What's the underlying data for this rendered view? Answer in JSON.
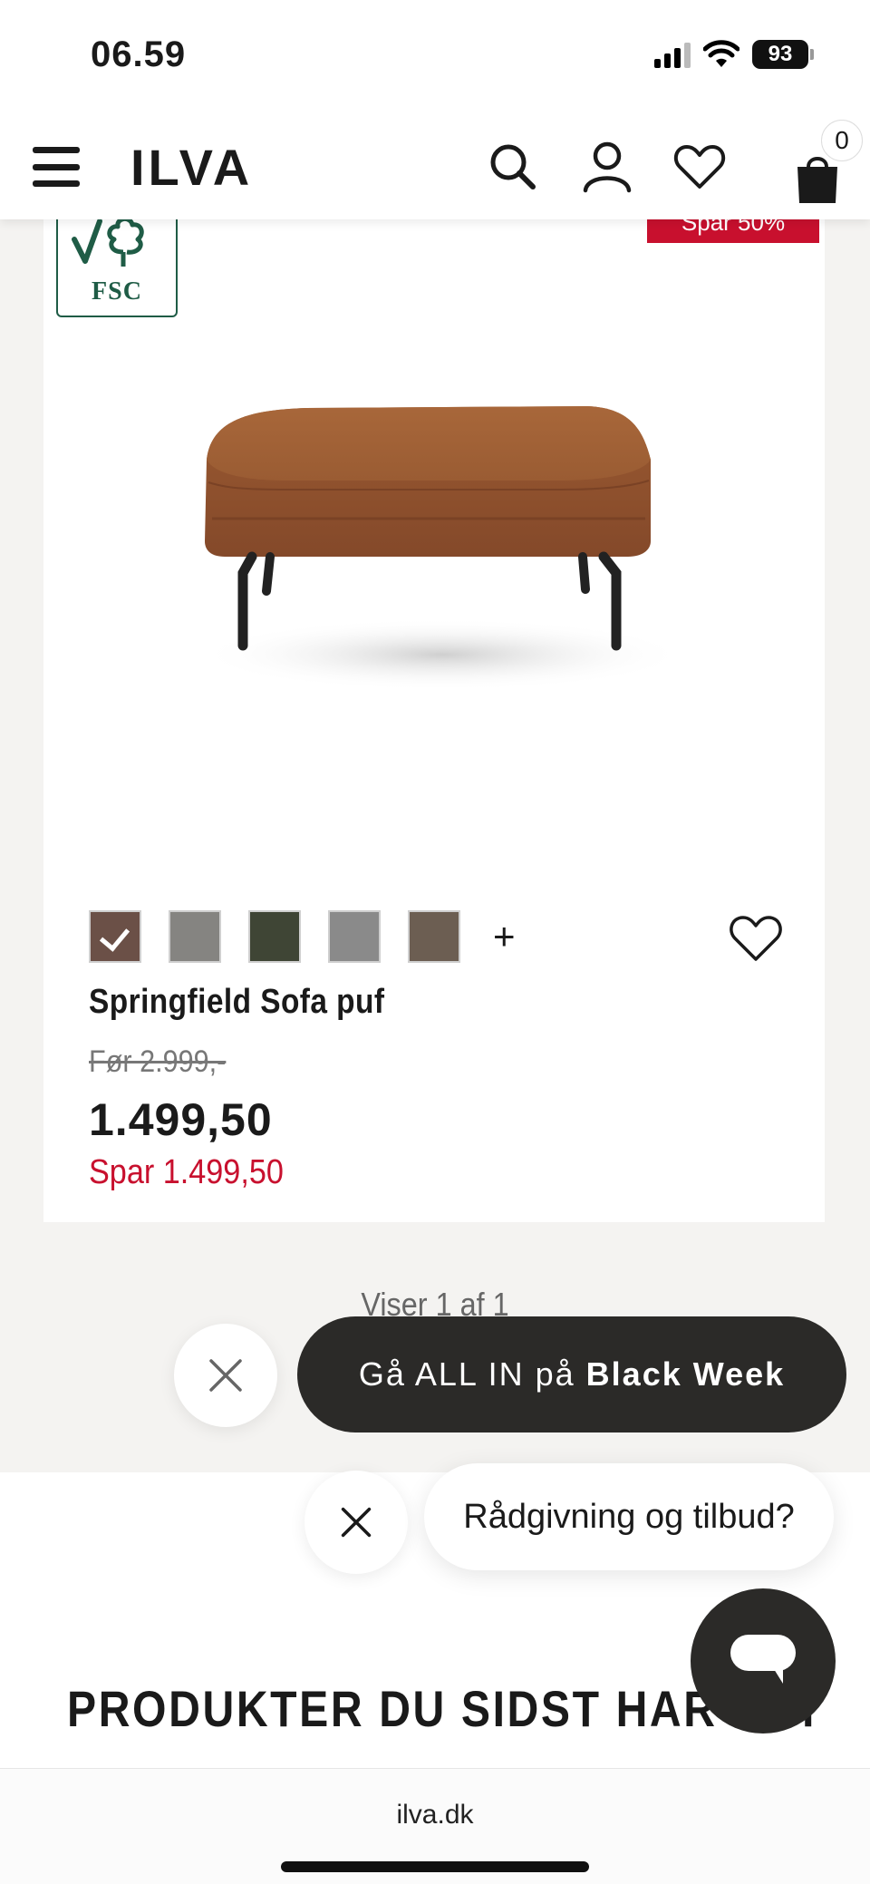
{
  "status_bar": {
    "time": "06.59",
    "battery": "93"
  },
  "header": {
    "logo": "ILVA",
    "cart_count": "0"
  },
  "product": {
    "fsc_label": "FSC",
    "sale_tag": "Spar 50%",
    "swatches": [
      {
        "color": "#6b5047",
        "selected": true
      },
      {
        "color": "#858481",
        "selected": false
      },
      {
        "color": "#3f4535",
        "selected": false
      },
      {
        "color": "#8a8a8a",
        "selected": false
      },
      {
        "color": "#6c5e52",
        "selected": false
      }
    ],
    "more_swatches_label": "+",
    "name": "Springfield Sofa puf",
    "old_price": "Før 2.999,-",
    "price": "1.499,50",
    "savings": "Spar 1.499,50"
  },
  "pagination": {
    "text": "Viser 1 af 1"
  },
  "promo": {
    "prefix": "Gå ALL IN på",
    "bold": "Black Week"
  },
  "chat": {
    "bubble_text": "Rådgivning og tilbud?"
  },
  "recently_viewed": {
    "title": "PRODUKTER DU SIDST HAR SET"
  },
  "browser": {
    "url": "ilva.dk"
  },
  "colors": {
    "accent_red": "#c8102e",
    "dark": "#2b2a28",
    "fsc_green": "#1f5c46"
  }
}
